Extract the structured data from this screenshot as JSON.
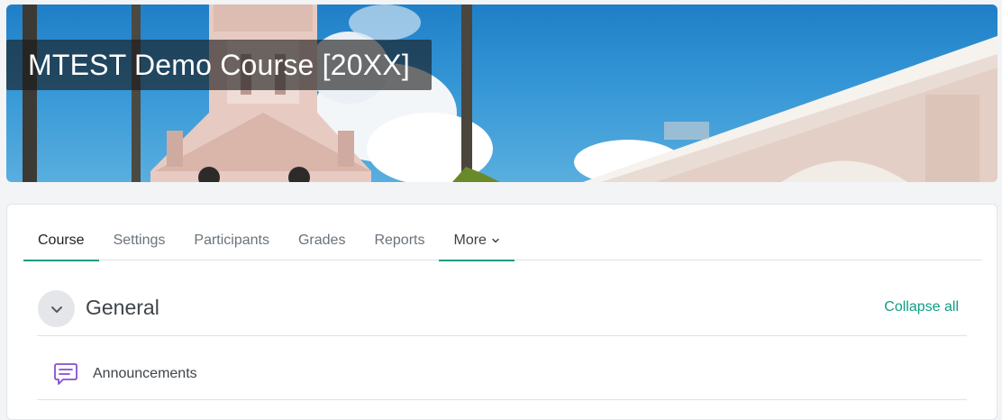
{
  "course": {
    "title": "MTEST Demo Course [20XX]"
  },
  "tabs": [
    {
      "label": "Course"
    },
    {
      "label": "Settings"
    },
    {
      "label": "Participants"
    },
    {
      "label": "Grades"
    },
    {
      "label": "Reports"
    },
    {
      "label": "More"
    }
  ],
  "section": {
    "title": "General",
    "collapse_all_label": "Collapse all",
    "toggle_icon": "chevron-down-icon"
  },
  "activities": [
    {
      "name": "Announcements",
      "icon": "forum-icon"
    }
  ],
  "colors": {
    "accent": "#0f9d84",
    "forum_icon": "#8a4ccf",
    "sky": "#2f8fd4"
  }
}
